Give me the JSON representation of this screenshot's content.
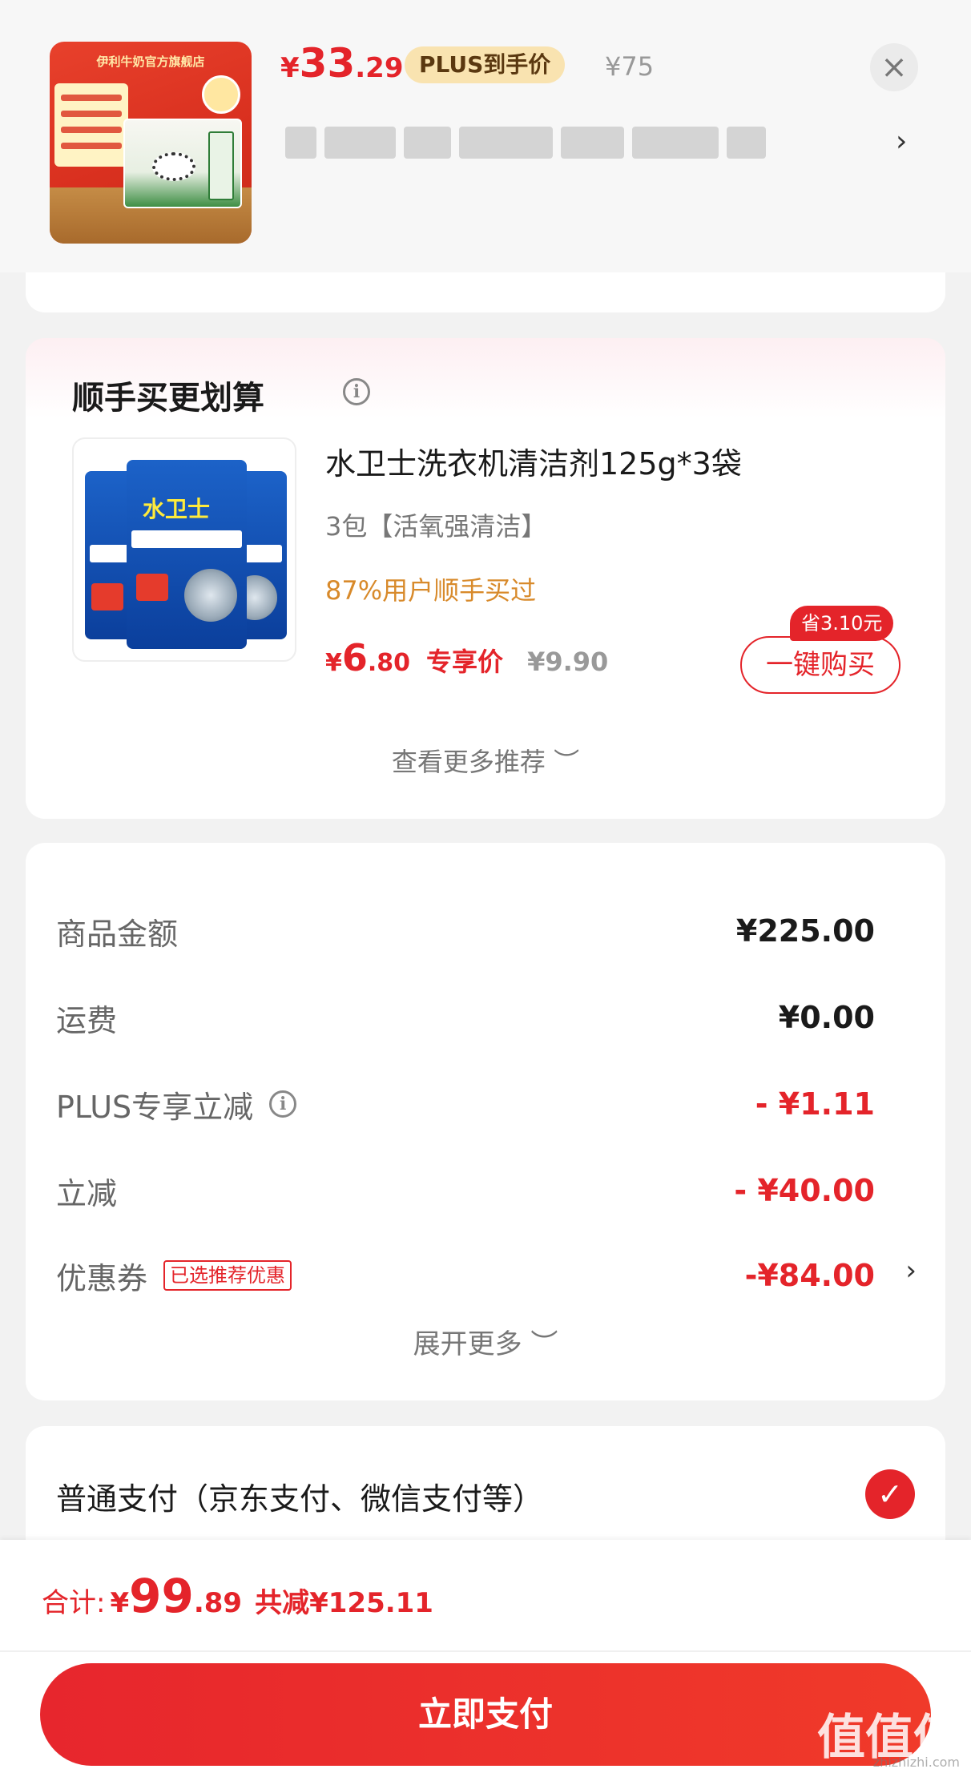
{
  "top_product": {
    "image_alt": "伊利牛奶官方旗舰店",
    "price_symbol": "¥",
    "price_int": "33",
    "price_dec": ".29",
    "price_tag": "PLUS到手价",
    "orig_price": "¥75",
    "close_icon": "close-icon",
    "chevron_icon": "chevron-right-icon"
  },
  "recommend": {
    "title": "顺手买更划算",
    "info_icon": "info-icon",
    "item": {
      "name": "水卫士洗衣机清洁剂125g*3袋",
      "spec": "3包【活氧强清洁】",
      "hint": "87%用户顺手买过",
      "price_symbol": "¥",
      "price_int": "6",
      "price_dec": ".80",
      "price_tag": "专享价",
      "orig_price": "¥9.90",
      "save_badge": "省3.10元",
      "buy_label": "一键购买",
      "brand_on_bag": "水卫士"
    },
    "more_label": "查看更多推荐 ︶"
  },
  "summary": {
    "rows": [
      {
        "label": "商品金额",
        "value": "¥225.00"
      },
      {
        "label": "运费",
        "value": "¥0.00"
      },
      {
        "label": "PLUS专享立减",
        "value": "- ¥1.11"
      },
      {
        "label": "立减",
        "value": "- ¥40.00"
      },
      {
        "label": "优惠券",
        "value": "-¥84.00"
      }
    ],
    "coupon_tag": "已选推荐优惠",
    "expand_label": "展开更多 ︶"
  },
  "payment": {
    "method_label": "普通支付（京东支付、微信支付等）"
  },
  "bottom": {
    "total_label": "合计:",
    "total_symbol": "¥",
    "total_int": "99",
    "total_dec": ".89",
    "total_saved": "共减¥125.11",
    "pay_button": "立即支付",
    "watermark": "值值值",
    "watermark_sub": "zhizhizhi.com"
  },
  "colors": {
    "accent_red": "#e4242a",
    "plus_gold": "#f9e3b0",
    "hint_orange": "#d88a2b"
  }
}
